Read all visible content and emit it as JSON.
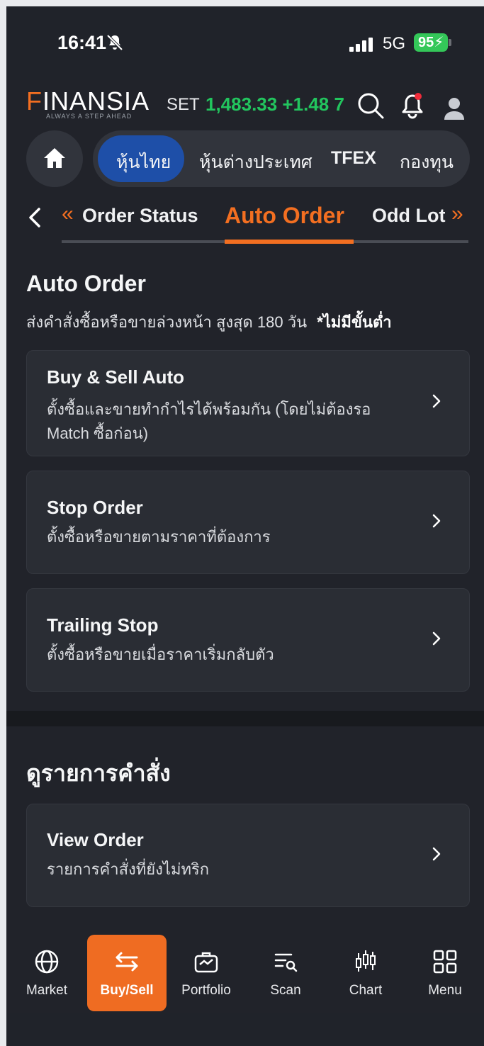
{
  "status_bar": {
    "time": "16:41",
    "network": "5G",
    "battery": "95"
  },
  "header": {
    "logo": "FINANSIA",
    "tagline": "ALWAYS A STEP AHEAD",
    "index_label": "SET",
    "index_value": "1,483.33 +1.48 7",
    "icons": [
      "search-icon",
      "bell-icon",
      "user-icon"
    ]
  },
  "categories": {
    "items": [
      "หุ้นไทย",
      "หุ้นต่างประเทศ",
      "TFEX",
      "กองทุน"
    ],
    "active": "หุ้นไทย"
  },
  "subtabs": {
    "items": [
      "Order Status",
      "Auto Order",
      "Odd Lot"
    ],
    "active": "Auto Order"
  },
  "auto_order": {
    "title": "Auto Order",
    "desc": "ส่งคำสั่งซื้อหรือขายล่วงหน้า สูงสุด 180 วัน",
    "desc_bold": "*ไม่มีขั้นต่ำ",
    "cards": [
      {
        "title": "Buy & Sell Auto",
        "desc_line1": "ตั้งซื้อและขายทำกำไรได้พร้อมกัน (โดยไม่ต้องรอ",
        "desc_line2": "Match ซื้อก่อน)"
      },
      {
        "title": "Stop Order",
        "desc_line1": "ตั้งซื้อหรือขายตามราคาที่ต้องการ"
      },
      {
        "title": "Trailing Stop",
        "desc_line1": "ตั้งซื้อหรือขายเมื่อราคาเริ่มกลับตัว"
      }
    ]
  },
  "view_orders": {
    "title": "ดูรายการคำสั่ง",
    "card": {
      "title": "View Order",
      "desc": "รายการคำสั่งที่ยังไม่ทริก"
    }
  },
  "bottom_nav": {
    "items": [
      "Market",
      "Buy/Sell",
      "Portfolio",
      "Scan",
      "Chart",
      "Menu"
    ],
    "active": "Buy/Sell"
  },
  "colors": {
    "accent": "#f36f21",
    "positive": "#22c55e",
    "active_tab": "#1e4fa8",
    "background": "#21232a"
  }
}
